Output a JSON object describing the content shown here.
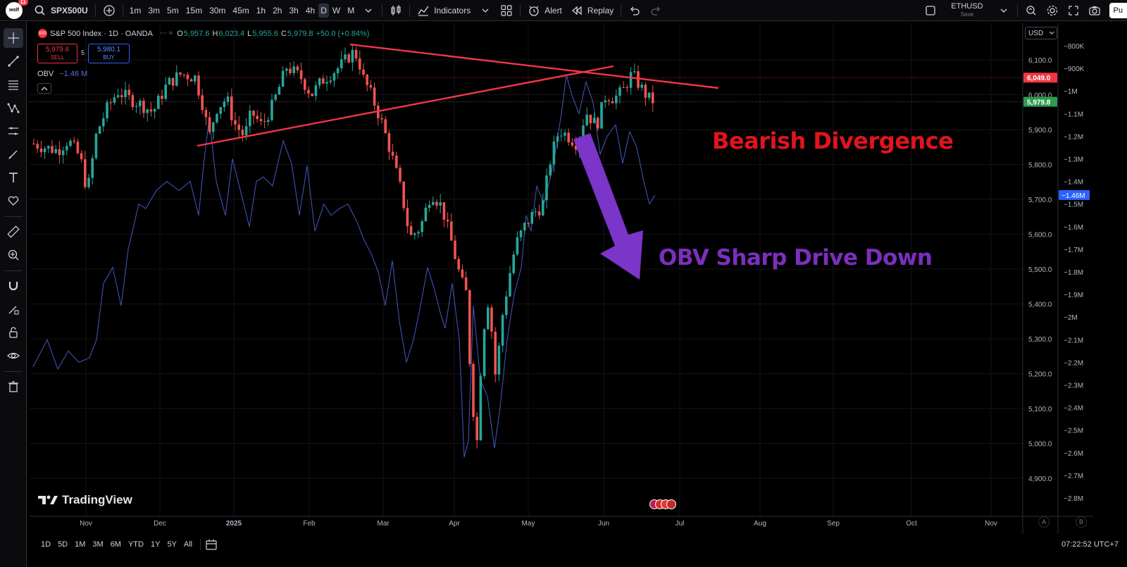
{
  "topbar": {
    "avatar_text": "wolf",
    "avatar_badge": "11",
    "symbol": "SPX500U",
    "intervals": [
      "1m",
      "3m",
      "5m",
      "15m",
      "30m",
      "45m",
      "1h",
      "2h",
      "3h",
      "4h",
      "D",
      "W",
      "M"
    ],
    "active_interval": "D",
    "indicators_label": "Indicators",
    "alert_label": "Alert",
    "replay_label": "Replay",
    "layout_symbol": "ETHUSD",
    "layout_save": "Save",
    "publish_label": "Pu"
  },
  "legend": {
    "symbol_logo": "500",
    "title": "S&P 500 Index · 1D · OANDA",
    "o_label": "O",
    "o_value": "5,957.6",
    "h_label": "H",
    "h_value": "6,023.4",
    "l_label": "L",
    "l_value": "5,955.6",
    "c_label": "C",
    "c_value": "5,979.8",
    "change": "+50.0 (+0.84%)",
    "sell_price": "5,979.6",
    "sell_label": "SELL",
    "spread": "5",
    "buy_price": "5,980.1",
    "buy_label": "BUY",
    "obv_label": "OBV",
    "obv_value": "−1.46 M"
  },
  "price_axis": {
    "currency": "USD",
    "ticks": [
      "6,100.0",
      "6,000.0",
      "5,900.0",
      "5,800.0",
      "5,700.0",
      "5,600.0",
      "5,500.0",
      "5,400.0",
      "5,300.0",
      "5,200.0",
      "5,100.0",
      "5,000.0",
      "4,900.0"
    ],
    "tick_values": [
      6100,
      6000,
      5900,
      5800,
      5700,
      5600,
      5500,
      5400,
      5300,
      5200,
      5100,
      5000,
      4900
    ],
    "red_tag": "6,049.0",
    "red_tag_value": 6049,
    "green_tag": "5,979.8",
    "green_tag_value": 5979.8
  },
  "obv_axis": {
    "ticks": [
      "−800K",
      "−900K",
      "−1M",
      "−1.1M",
      "−1.2M",
      "−1.3M",
      "−1.4M",
      "−1.5M",
      "−1.6M",
      "−1.7M",
      "−1.8M",
      "−1.9M",
      "−2M",
      "−2.1M",
      "−2.2M",
      "−2.3M",
      "−2.4M",
      "−2.5M",
      "−2.6M",
      "−2.7M",
      "−2.8M"
    ],
    "blue_tag": "−1.46M"
  },
  "time_axis": {
    "labels": [
      "Nov",
      "Dec",
      "2025",
      "Feb",
      "Mar",
      "Apr",
      "May",
      "Jun",
      "Jul",
      "Aug",
      "Sep",
      "Oct",
      "Nov"
    ]
  },
  "annotations": {
    "bearish": "Bearish Divergence",
    "obv_drive": "OBV Sharp Drive Down"
  },
  "watermark": "TradingView",
  "bottombar": {
    "ranges": [
      "1D",
      "5D",
      "1M",
      "3M",
      "6M",
      "YTD",
      "1Y",
      "5Y",
      "All"
    ],
    "clock": "07:22:52 UTC+7",
    "axis_mode_a": "A",
    "axis_mode_b": "B"
  },
  "colors": {
    "up": "#26a69a",
    "down": "#ef5350",
    "obv": "#3f51b5",
    "trendline": "#f23645",
    "bearish_text": "#e0141e",
    "obv_text": "#7b2fbe",
    "arrow": "#7b35c8"
  },
  "chart_data": {
    "type": "candlestick",
    "title": "S&P 500 Index · 1D · OANDA",
    "price_range": [
      4840,
      6175
    ],
    "obv_range_millions": [
      -2.85,
      -0.72
    ],
    "x_time_labels": [
      "Nov",
      "Dec",
      "2025",
      "Feb",
      "Mar",
      "Apr",
      "May",
      "Jun",
      "Jul",
      "Aug",
      "Sep",
      "Oct",
      "Nov"
    ],
    "closes_monthly_approx": {
      "Oct": 5830,
      "Nov": 6030,
      "Dec": 5880,
      "Jan": 6040,
      "Feb": 5950,
      "Mar": 5600,
      "Apr": 5560,
      "May": 5900,
      "Jun": 5980
    },
    "last": {
      "open": 5957.6,
      "high": 6023.4,
      "low": 5955.6,
      "close": 5979.8
    },
    "obv_last": "-1.46M",
    "trendlines": [
      {
        "name": "upper resistance",
        "from": {
          "date": "2025-02-19",
          "price": 6160
        },
        "to": {
          "date": "2025-07-18",
          "price": 6010
        }
      },
      {
        "name": "rising support",
        "from": {
          "date": "2024-12-18",
          "price": 5840
        },
        "to": {
          "date": "2025-06-05",
          "price": 6090
        }
      }
    ]
  }
}
